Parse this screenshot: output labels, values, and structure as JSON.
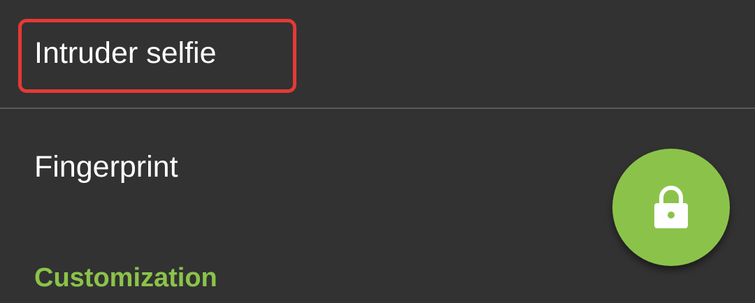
{
  "settings": {
    "items": [
      {
        "label": "Intruder selfie",
        "highlighted": true
      },
      {
        "label": "Fingerprint",
        "highlighted": false
      }
    ],
    "section_header": "Customization"
  },
  "fab": {
    "icon": "lock-icon"
  },
  "colors": {
    "background": "#323232",
    "accent": "#8bc34a",
    "highlight": "#e53935",
    "text": "#ffffff"
  }
}
